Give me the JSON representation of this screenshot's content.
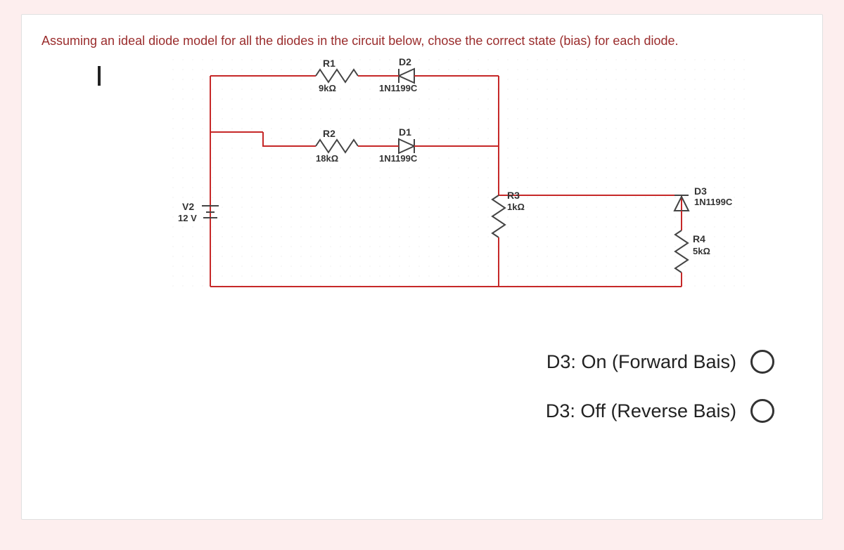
{
  "question": "Assuming an ideal diode model for all the diodes in the circuit below, chose the correct state (bias) for each diode.",
  "components": {
    "R1": {
      "name": "R1",
      "value": "9kΩ"
    },
    "R2": {
      "name": "R2",
      "value": "18kΩ"
    },
    "R3": {
      "name": "R3",
      "value": "1kΩ"
    },
    "R4": {
      "name": "R4",
      "value": "5kΩ"
    },
    "D1": {
      "name": "D1",
      "model": "1N1199C"
    },
    "D2": {
      "name": "D2",
      "model": "1N1199C"
    },
    "D3": {
      "name": "D3",
      "model": "1N1199C"
    },
    "V2": {
      "name": "V2",
      "value": "12 V"
    }
  },
  "answers": [
    {
      "label": "D3: On (Forward Bais)"
    },
    {
      "label": "D3: Off (Reverse Bais)"
    }
  ]
}
